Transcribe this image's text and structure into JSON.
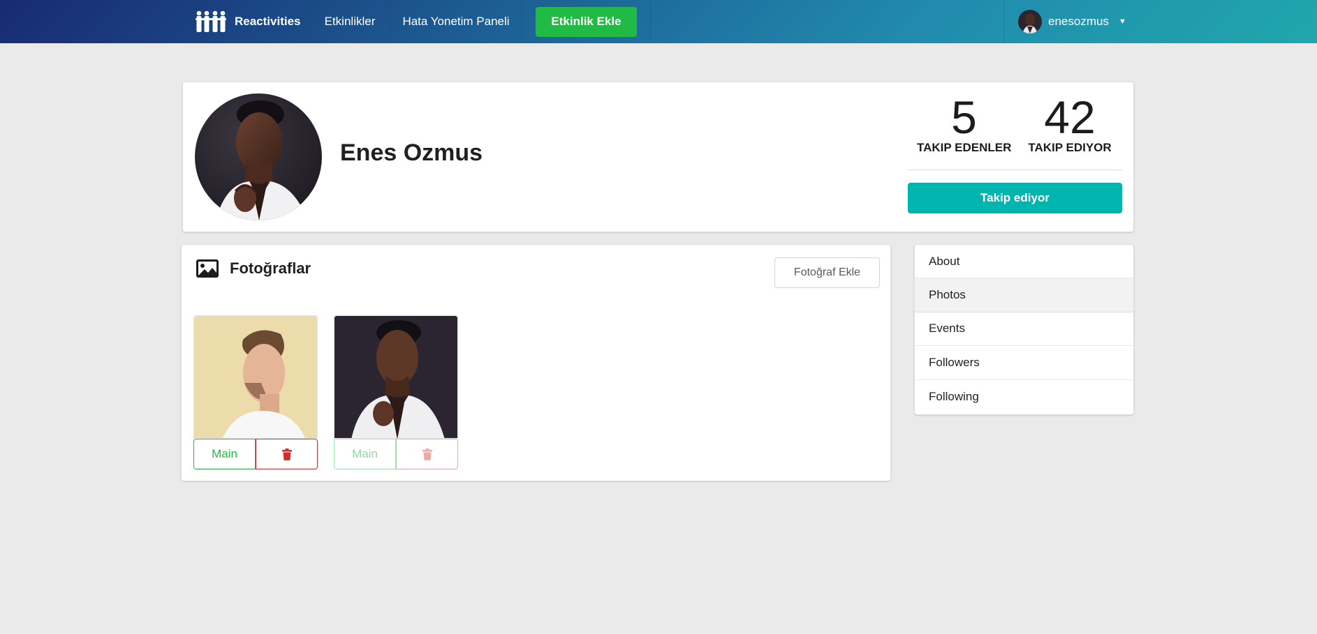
{
  "navbar": {
    "brand": "Reactivities",
    "activities": "Etkinlikler",
    "errors": "Hata Yonetim Paneli",
    "create_activity": "Etkinlik Ekle",
    "username": "enesozmus",
    "brand_logo_icon": "people-group-icon",
    "dropdown_icon": "caret-down-icon"
  },
  "profile": {
    "display_name": "Enes Ozmus",
    "followers_count": "5",
    "followers_label": "TAKIP EDENLER",
    "following_count": "42",
    "following_label": "TAKIP EDIYOR",
    "follow_button": "Takip ediyor"
  },
  "photos": {
    "title": "Fotoğraflar",
    "title_icon": "image-icon",
    "add_button": "Fotoğraf Ekle",
    "items": [
      {
        "main_label": "Main",
        "delete_icon": "trash-icon",
        "enabled": true
      },
      {
        "main_label": "Main",
        "delete_icon": "trash-icon",
        "enabled": false
      }
    ]
  },
  "menu": {
    "items": [
      {
        "label": "About"
      },
      {
        "label": "Photos",
        "active": true
      },
      {
        "label": "Events"
      },
      {
        "label": "Followers"
      },
      {
        "label": "Following"
      }
    ]
  },
  "colors": {
    "nav_gradient_start": "#182a73",
    "nav_gradient_end": "#20a7ac",
    "positive": "#21ba45",
    "teal": "#00b5ad",
    "negative": "#db2828",
    "background": "#eaeaea"
  }
}
